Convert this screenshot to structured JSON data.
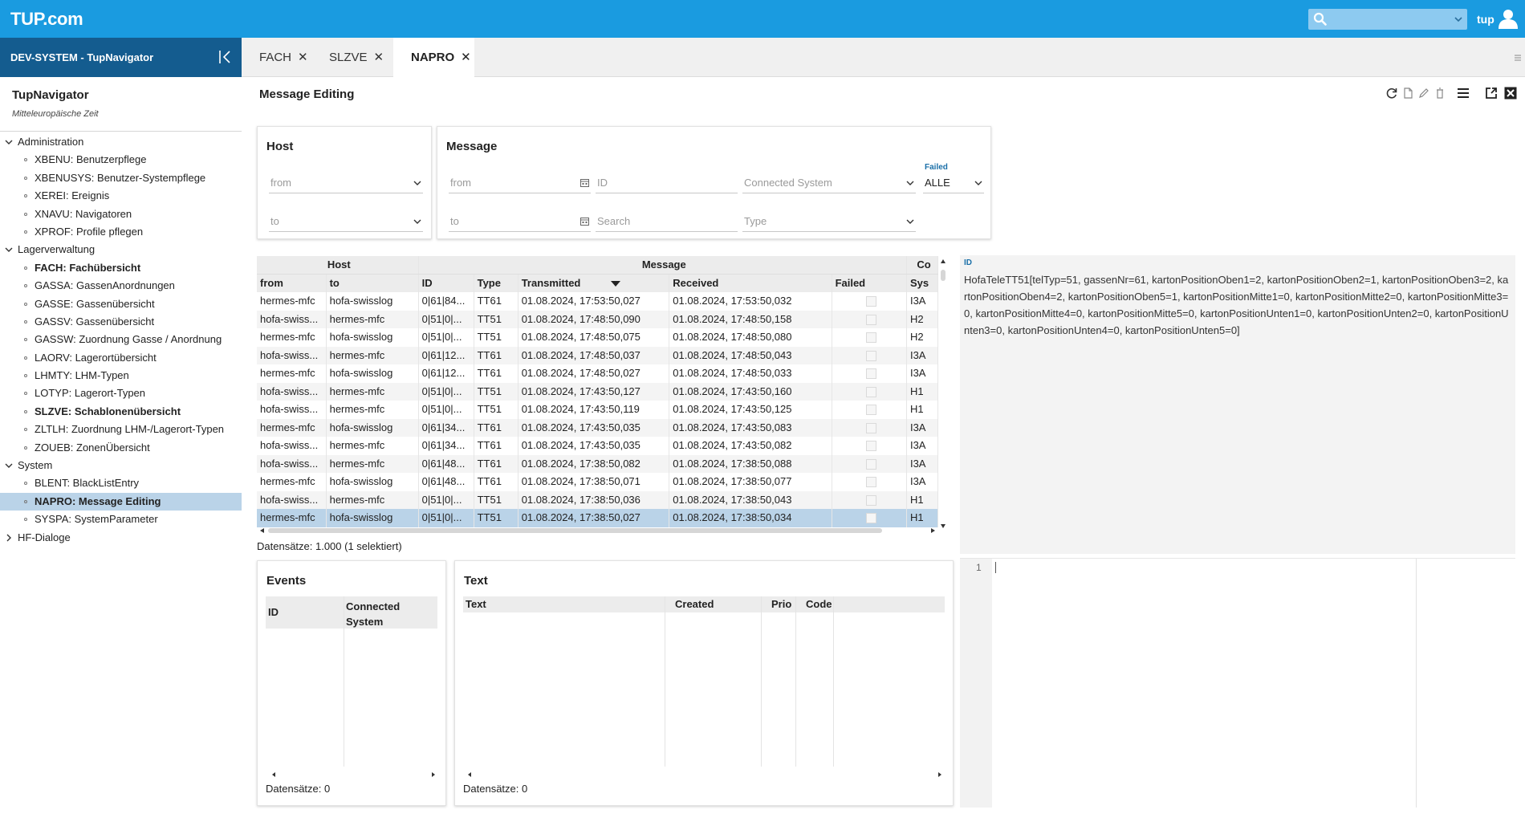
{
  "app": {
    "logo": "TUP.com",
    "user": "tup"
  },
  "sidebar": {
    "header": "DEV-SYSTEM - TupNavigator",
    "nav_title": "TupNavigator",
    "nav_subtitle": "Mitteleuropäische Zeit",
    "tree": [
      {
        "label": "Administration",
        "kind": "group",
        "expanded": true
      },
      {
        "label": "XBENU: Benutzerpflege",
        "kind": "item"
      },
      {
        "label": "XBENUSYS: Benutzer-Systempflege",
        "kind": "item"
      },
      {
        "label": "XEREI: Ereignis",
        "kind": "item"
      },
      {
        "label": "XNAVU: Navigatoren",
        "kind": "item"
      },
      {
        "label": "XPROF: Profile pflegen",
        "kind": "item"
      },
      {
        "label": "Lagerverwaltung",
        "kind": "group",
        "expanded": true
      },
      {
        "label": "FACH: Fachübersicht",
        "kind": "item",
        "bold": true
      },
      {
        "label": "GASSA: GassenAnordnungen",
        "kind": "item"
      },
      {
        "label": "GASSE: Gassenübersicht",
        "kind": "item"
      },
      {
        "label": "GASSV: Gassenübersicht",
        "kind": "item"
      },
      {
        "label": "GASSW: Zuordnung Gasse / Anordnung",
        "kind": "item"
      },
      {
        "label": "LAORV: Lagerortübersicht",
        "kind": "item"
      },
      {
        "label": "LHMTY: LHM-Typen",
        "kind": "item"
      },
      {
        "label": "LOTYP: Lagerort-Typen",
        "kind": "item"
      },
      {
        "label": "SLZVE: Schablonenübersicht",
        "kind": "item",
        "bold": true
      },
      {
        "label": "ZLTLH: Zuordnung LHM-/Lagerort-Typen",
        "kind": "item"
      },
      {
        "label": "ZOUEB: ZonenÜbersicht",
        "kind": "item"
      },
      {
        "label": "System",
        "kind": "group",
        "expanded": true
      },
      {
        "label": "BLENT: BlackListEntry",
        "kind": "item"
      },
      {
        "label": "NAPRO: Message Editing",
        "kind": "item",
        "selected": true
      },
      {
        "label": "SYSPA: SystemParameter",
        "kind": "item"
      },
      {
        "label": "HF-Dialoge",
        "kind": "group",
        "expanded": false
      }
    ]
  },
  "tabs": [
    {
      "label": "FACH",
      "active": false
    },
    {
      "label": "SLZVE",
      "active": false
    },
    {
      "label": "NAPRO",
      "active": true
    }
  ],
  "page": {
    "title": "Message Editing"
  },
  "host_filter": {
    "title": "Host",
    "from_placeholder": "from",
    "to_placeholder": "to"
  },
  "message_filter": {
    "title": "Message",
    "from_placeholder": "from",
    "to_placeholder": "to",
    "id_placeholder": "ID",
    "search_placeholder": "Search",
    "connected_system_placeholder": "Connected System",
    "type_placeholder": "Type",
    "failed_label": "Failed",
    "failed_value": "ALLE"
  },
  "grid": {
    "group_headers": {
      "host": "Host",
      "message": "Message",
      "connected": "Co"
    },
    "columns": {
      "from": "from",
      "to": "to",
      "id": "ID",
      "type": "Type",
      "transmitted": "Transmitted",
      "received": "Received",
      "failed": "Failed",
      "system": "Sys"
    },
    "rows": [
      {
        "from": "hermes-mfc",
        "to": "hofa-swisslog",
        "id": "0|61|84...",
        "type": "TT61",
        "transmitted": "01.08.2024, 17:53:50,027",
        "received": "01.08.2024, 17:53:50,032",
        "system": "I3A"
      },
      {
        "from": "hofa-swiss...",
        "to": "hermes-mfc",
        "id": "0|51|0|...",
        "type": "TT51",
        "transmitted": "01.08.2024, 17:48:50,090",
        "received": "01.08.2024, 17:48:50,158",
        "system": "H2"
      },
      {
        "from": "hermes-mfc",
        "to": "hofa-swisslog",
        "id": "0|51|0|...",
        "type": "TT51",
        "transmitted": "01.08.2024, 17:48:50,075",
        "received": "01.08.2024, 17:48:50,080",
        "system": "H2"
      },
      {
        "from": "hofa-swiss...",
        "to": "hermes-mfc",
        "id": "0|61|12...",
        "type": "TT61",
        "transmitted": "01.08.2024, 17:48:50,037",
        "received": "01.08.2024, 17:48:50,043",
        "system": "I3A"
      },
      {
        "from": "hermes-mfc",
        "to": "hofa-swisslog",
        "id": "0|61|12...",
        "type": "TT61",
        "transmitted": "01.08.2024, 17:48:50,027",
        "received": "01.08.2024, 17:48:50,033",
        "system": "I3A"
      },
      {
        "from": "hofa-swiss...",
        "to": "hermes-mfc",
        "id": "0|51|0|...",
        "type": "TT51",
        "transmitted": "01.08.2024, 17:43:50,127",
        "received": "01.08.2024, 17:43:50,160",
        "system": "H1"
      },
      {
        "from": "hofa-swiss...",
        "to": "hermes-mfc",
        "id": "0|51|0|...",
        "type": "TT51",
        "transmitted": "01.08.2024, 17:43:50,119",
        "received": "01.08.2024, 17:43:50,125",
        "system": "H1"
      },
      {
        "from": "hermes-mfc",
        "to": "hofa-swisslog",
        "id": "0|61|34...",
        "type": "TT61",
        "transmitted": "01.08.2024, 17:43:50,035",
        "received": "01.08.2024, 17:43:50,083",
        "system": "I3A"
      },
      {
        "from": "hofa-swiss...",
        "to": "hermes-mfc",
        "id": "0|61|34...",
        "type": "TT61",
        "transmitted": "01.08.2024, 17:43:50,035",
        "received": "01.08.2024, 17:43:50,082",
        "system": "I3A"
      },
      {
        "from": "hofa-swiss...",
        "to": "hermes-mfc",
        "id": "0|61|48...",
        "type": "TT61",
        "transmitted": "01.08.2024, 17:38:50,082",
        "received": "01.08.2024, 17:38:50,088",
        "system": "I3A"
      },
      {
        "from": "hermes-mfc",
        "to": "hofa-swisslog",
        "id": "0|61|48...",
        "type": "TT61",
        "transmitted": "01.08.2024, 17:38:50,071",
        "received": "01.08.2024, 17:38:50,077",
        "system": "I3A"
      },
      {
        "from": "hofa-swiss...",
        "to": "hermes-mfc",
        "id": "0|51|0|...",
        "type": "TT51",
        "transmitted": "01.08.2024, 17:38:50,036",
        "received": "01.08.2024, 17:38:50,043",
        "system": "H1"
      },
      {
        "from": "hermes-mfc",
        "to": "hofa-swisslog",
        "id": "0|51|0|...",
        "type": "TT51",
        "transmitted": "01.08.2024, 17:38:50,027",
        "received": "01.08.2024, 17:38:50,034",
        "system": "H1",
        "selected": true
      }
    ],
    "count": "Datensätze: 1.000 (1 selektiert)"
  },
  "detail": {
    "label": "ID",
    "text": "HofaTeleTT51[telTyp=51, gassenNr=61, kartonPositionOben1=2, kartonPositionOben2=1, kartonPositionOben3=2, kartonPositionOben4=2, kartonPositionOben5=1, kartonPositionMitte1=0, kartonPositionMitte2=0, kartonPositionMitte3=0, kartonPositionMitte4=0, kartonPositionMitte5=0, kartonPositionUnten1=0, kartonPositionUnten2=0, kartonPositionUnten3=0, kartonPositionUnten4=0, kartonPositionUnten5=0]"
  },
  "editor": {
    "line_number": "1"
  },
  "events": {
    "title": "Events",
    "col_id": "ID",
    "col_connected": "Connected System",
    "count": "Datensätze: 0"
  },
  "text_panel": {
    "title": "Text",
    "col_text": "Text",
    "col_created": "Created",
    "col_prio": "Prio",
    "col_code": "Code",
    "count": "Datensätze: 0"
  }
}
